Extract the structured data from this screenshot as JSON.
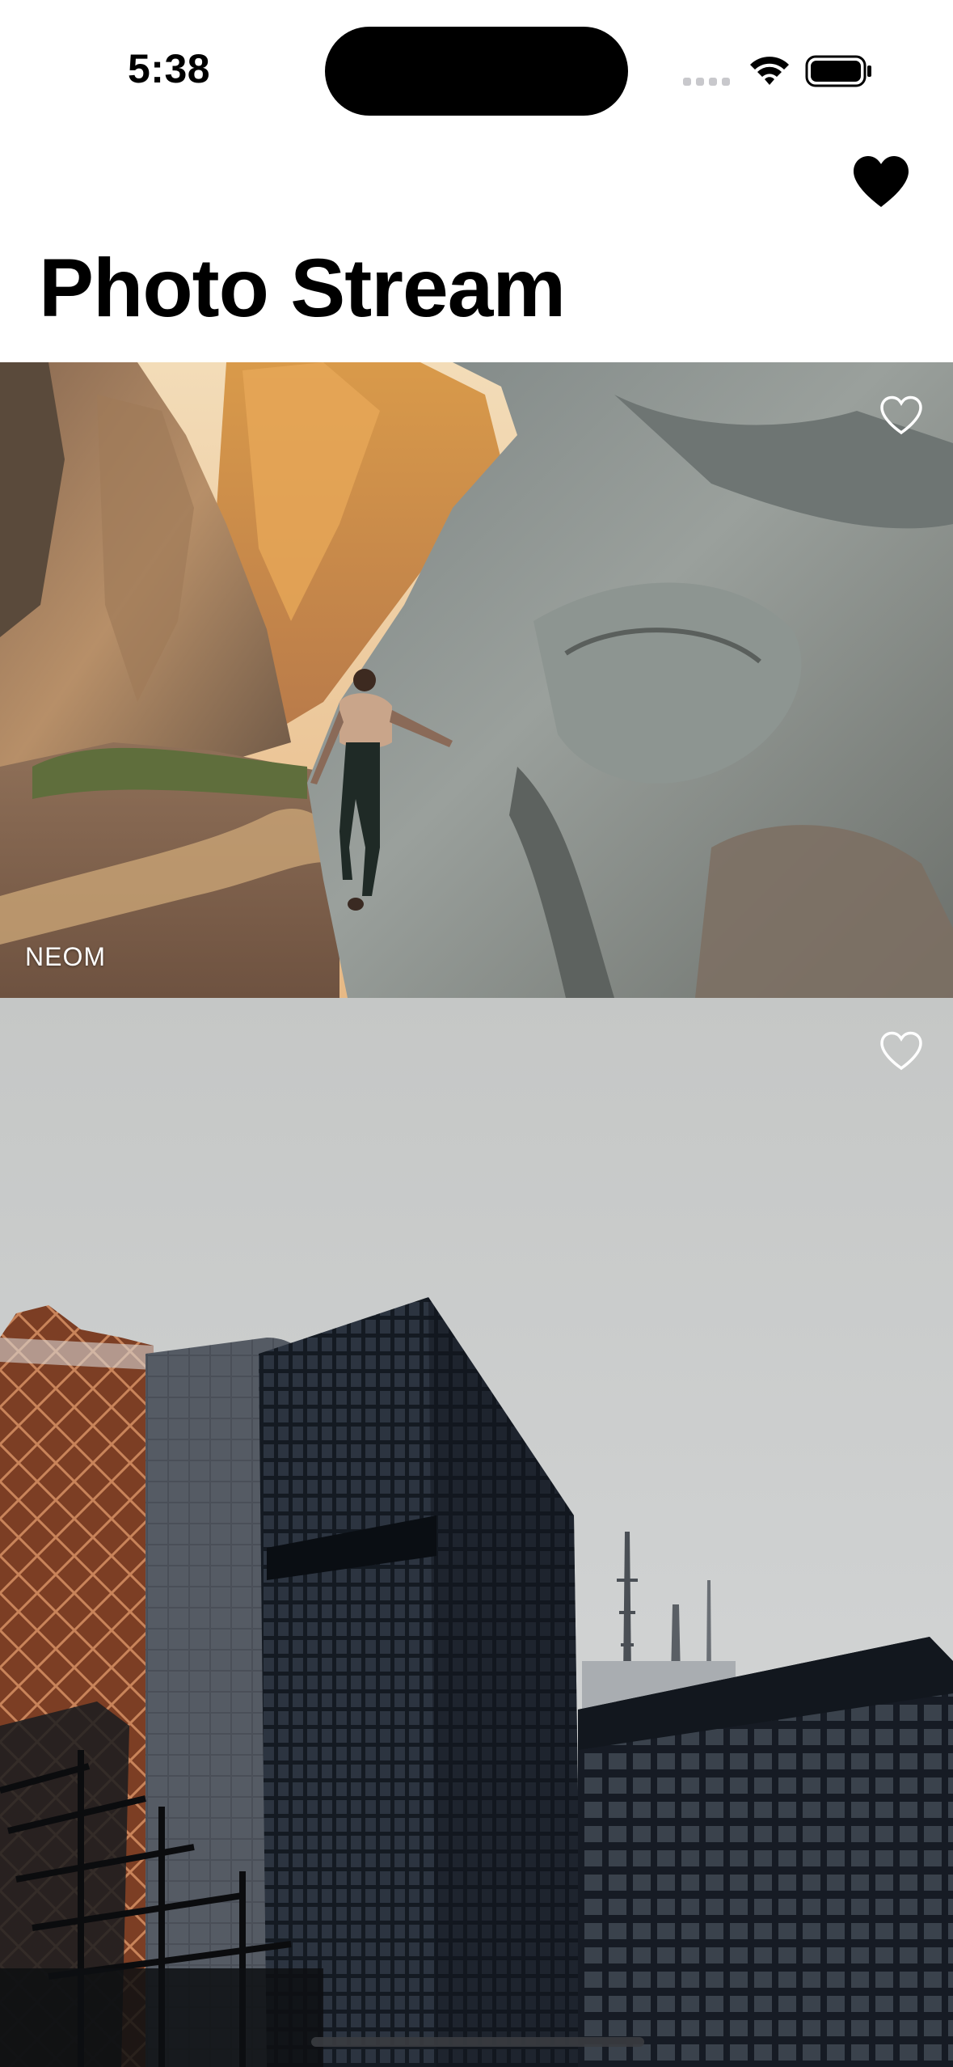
{
  "status_bar": {
    "time": "5:38",
    "icons": [
      "cellular-signal-icon",
      "wifi-icon",
      "battery-icon"
    ]
  },
  "nav": {
    "favorites_icon": "heart-filled-icon"
  },
  "page": {
    "title": "Photo Stream"
  },
  "photos": [
    {
      "location": "NEOM",
      "subject": "hiker walking along a rocky canyon trail",
      "favorite_icon": "heart-outline-icon",
      "favorited": false
    },
    {
      "subject": "dark glass office towers against a grey sky",
      "favorite_icon": "heart-outline-icon",
      "favorited": false
    }
  ],
  "colors": {
    "background": "#ffffff",
    "title_text": "#000000",
    "overlay_text": "#ffffff"
  }
}
